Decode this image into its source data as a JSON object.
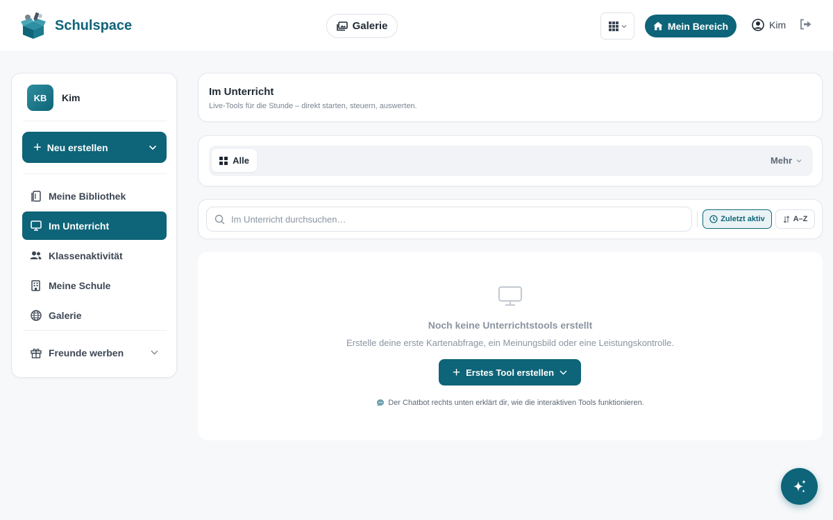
{
  "brand": {
    "name": "Schulspace"
  },
  "header": {
    "gallery_label": "Galerie",
    "mein_bereich_label": "Mein Bereich",
    "user_name": "Kim"
  },
  "sidebar": {
    "profile": {
      "initials": "KB",
      "name": "Kim"
    },
    "new_button_label": "Neu erstellen",
    "items": [
      {
        "label": "Meine Bibliothek",
        "icon": "book-icon",
        "active": false
      },
      {
        "label": "Im Unterricht",
        "icon": "monitor-icon",
        "active": true
      },
      {
        "label": "Klassenaktivität",
        "icon": "users-icon",
        "active": false
      },
      {
        "label": "Meine Schule",
        "icon": "building-icon",
        "active": false
      },
      {
        "label": "Galerie",
        "icon": "globe-icon",
        "active": false
      }
    ],
    "referral_label": "Freunde werben"
  },
  "main": {
    "title": "Im Unterricht",
    "subtitle": "Live-Tools für die Stunde – direkt starten, steuern, auswerten.",
    "filter": {
      "all_label": "Alle",
      "more_label": "Mehr"
    },
    "search": {
      "placeholder": "Im Unterricht durchsuchen…",
      "value": ""
    },
    "sort": {
      "recent_label": "Zuletzt aktiv",
      "az_label": "A–Z",
      "selected": "Zuletzt aktiv"
    },
    "empty": {
      "title": "Noch keine Unterrichtstools erstellt",
      "text": "Erstelle deine erste Kartenabfrage, ein Meinungsbild oder eine Leistungskontrolle.",
      "button_label": "Erstes Tool erstellen",
      "hint": "Der Chatbot rechts unten erklärt dir, wie die interaktiven Tools funktionieren."
    }
  },
  "colors": {
    "accent": "#0e6478",
    "accent_light": "#e9f3f5",
    "muted_text": "#8a94a0"
  }
}
